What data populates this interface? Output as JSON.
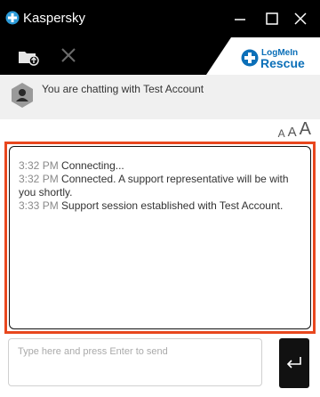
{
  "window": {
    "title": "Kaspersky",
    "accent_color": "#e8471e",
    "titlebar_color": "#000000"
  },
  "toolbar": {
    "folder_icon": "folder-upload-icon",
    "stop_icon": "close-icon"
  },
  "brand": {
    "line1": "LogMeIn",
    "line2": "Rescue",
    "color": "#0b6fb8"
  },
  "chat": {
    "with_text": "You are chatting with Test Account",
    "font_sizes": [
      "A",
      "A",
      "A"
    ],
    "messages": [
      {
        "time": "3:32 PM",
        "text": "Connecting..."
      },
      {
        "time": "3:32 PM",
        "text": "Connected. A support representative will be with you shortly."
      },
      {
        "time": "3:33 PM",
        "text": "Support session established with Test Account."
      }
    ]
  },
  "input": {
    "placeholder": "Type here and press Enter to send",
    "send_icon": "enter-arrow-icon"
  }
}
